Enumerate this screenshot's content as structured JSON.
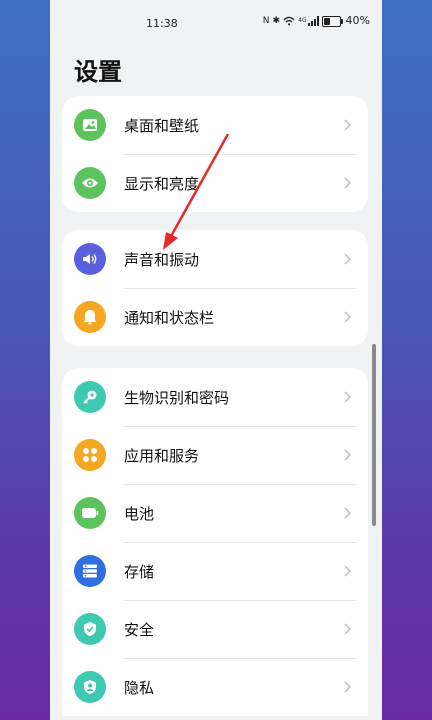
{
  "status": {
    "time": "11:38",
    "battery": "40%",
    "battery_level": 0.4,
    "network": "4G"
  },
  "page_title": "设置",
  "groups": [
    {
      "items": [
        {
          "label": "桌面和壁纸",
          "icon": "wallpaper-icon",
          "color": "#5cc35d"
        },
        {
          "label": "显示和亮度",
          "icon": "eye-icon",
          "color": "#5cc35d"
        }
      ]
    },
    {
      "items": [
        {
          "label": "声音和振动",
          "icon": "volume-icon",
          "color": "#5a5fe0"
        },
        {
          "label": "通知和状态栏",
          "icon": "bell-icon",
          "color": "#f5a623"
        }
      ]
    },
    {
      "items": [
        {
          "label": "生物识别和密码",
          "icon": "key-icon",
          "color": "#3fc8b2"
        },
        {
          "label": "应用和服务",
          "icon": "apps-icon",
          "color": "#f5a623"
        },
        {
          "label": "电池",
          "icon": "battery-icon",
          "color": "#5cc35d"
        },
        {
          "label": "存储",
          "icon": "storage-icon",
          "color": "#2f6fe0"
        },
        {
          "label": "安全",
          "icon": "shield-icon",
          "color": "#3fc8b2"
        },
        {
          "label": "隐私",
          "icon": "privacy-icon",
          "color": "#3fc8b2"
        }
      ]
    }
  ],
  "annotation_color": "#e52b2b"
}
